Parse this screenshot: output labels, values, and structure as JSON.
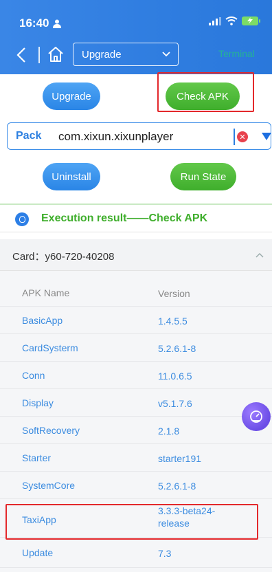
{
  "status_bar": {
    "time": "16:40"
  },
  "nav": {
    "select_value": "Upgrade",
    "terminal_label": "Terminal"
  },
  "buttons": {
    "upgrade": "Upgrade",
    "check_apk": "Check APK",
    "uninstall": "Uninstall",
    "run_state": "Run State"
  },
  "pack": {
    "label": "Pack",
    "value": "com.xixun.xixunplayer"
  },
  "execution": {
    "text": "Execution result——Check APK"
  },
  "card": {
    "title": "Card：y60-720-40208"
  },
  "table": {
    "headers": {
      "name": "APK Name",
      "version": "Version"
    },
    "rows": [
      {
        "name": "BasicApp",
        "version": "1.4.5.5"
      },
      {
        "name": "CardSysterm",
        "version": "5.2.6.1-8"
      },
      {
        "name": "Conn",
        "version": "11.0.6.5"
      },
      {
        "name": "Display",
        "version": "v5.1.7.6"
      },
      {
        "name": "SoftRecovery",
        "version": "2.1.8"
      },
      {
        "name": "Starter",
        "version": "starter191"
      },
      {
        "name": "SystemCore",
        "version": "5.2.6.1-8"
      },
      {
        "name": "TaxiApp",
        "version": "3.3.3-beta24-\nrelease"
      },
      {
        "name": "Update",
        "version": "7.3"
      }
    ]
  },
  "colors": {
    "header_blue": "#2f7de0",
    "green": "#3fae2c",
    "highlight_red": "#e3282b",
    "link_blue": "#3c8ce0"
  }
}
